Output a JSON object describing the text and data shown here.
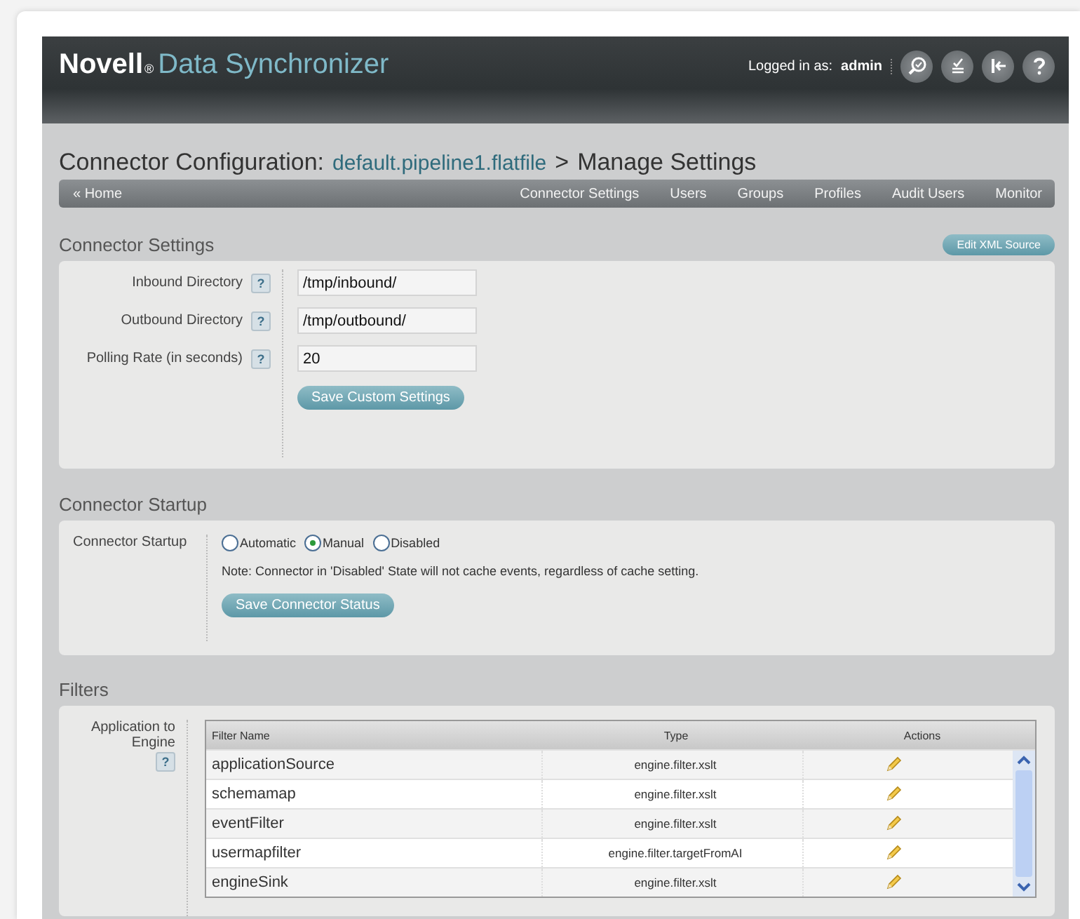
{
  "header": {
    "brand": "Novell",
    "registered": "®",
    "product": "Data Synchronizer",
    "logged_in_label": "Logged in as:",
    "user": "admin"
  },
  "page_title": {
    "prefix": "Connector Configuration:",
    "connector": "default.pipeline1.flatfile",
    "separator": ">",
    "suffix": "Manage Settings"
  },
  "nav": {
    "home": "« Home",
    "items": [
      "Connector Settings",
      "Users",
      "Groups",
      "Profiles",
      "Audit Users",
      "Monitor"
    ]
  },
  "connector_settings": {
    "title": "Connector Settings",
    "edit_button": "Edit XML Source",
    "fields": [
      {
        "label": "Inbound Directory",
        "help": "?",
        "value": "/tmp/inbound/"
      },
      {
        "label": "Outbound Directory",
        "help": "?",
        "value": "/tmp/outbound/"
      },
      {
        "label": "Polling Rate (in seconds)",
        "help": "?",
        "value": "20"
      }
    ],
    "save_button": "Save Custom Settings"
  },
  "connector_startup": {
    "title": "Connector Startup",
    "label": "Connector Startup",
    "options": [
      {
        "label": "Automatic",
        "selected": false
      },
      {
        "label": "Manual",
        "selected": true
      },
      {
        "label": "Disabled",
        "selected": false
      }
    ],
    "note": "Note: Connector in 'Disabled' State will not cache events, regardless of cache setting.",
    "save_button": "Save Connector Status"
  },
  "filters": {
    "title": "Filters",
    "label": "Application to Engine",
    "help": "?",
    "columns": [
      "Filter Name",
      "Type",
      "Actions"
    ],
    "rows": [
      {
        "name": "applicationSource",
        "type": "engine.filter.xslt"
      },
      {
        "name": "schemamap",
        "type": "engine.filter.xslt"
      },
      {
        "name": "eventFilter",
        "type": "engine.filter.xslt"
      },
      {
        "name": "usermapfilter",
        "type": "engine.filter.targetFromAI"
      },
      {
        "name": "engineSink",
        "type": "engine.filter.xslt"
      }
    ]
  }
}
